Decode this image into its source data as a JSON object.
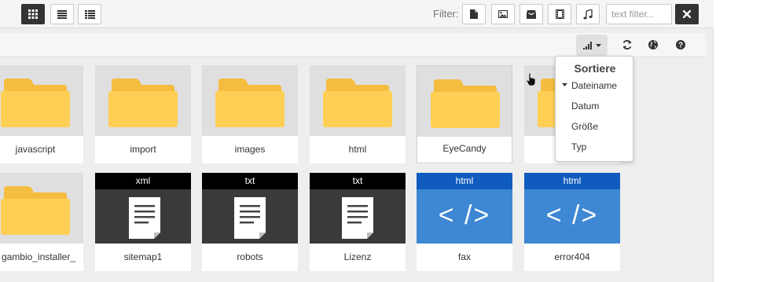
{
  "toolbar": {
    "view_buttons": [
      {
        "icon": "grid-view-icon",
        "active": true
      },
      {
        "icon": "list-view-icon",
        "active": false
      },
      {
        "icon": "columns-view-icon",
        "active": false
      }
    ],
    "filter_label": "Filter:",
    "filter_buttons": [
      "document-icon",
      "image-icon",
      "archive-icon",
      "video-icon",
      "music-icon"
    ],
    "filter_placeholder": "text filter...",
    "filter_value": "",
    "clear_icon": "close-icon"
  },
  "subbar": {
    "sort_icon": "signal-bars-icon",
    "icons": [
      "refresh-icon",
      "globe-icon",
      "help-icon"
    ]
  },
  "sort_menu": {
    "title": "Sortiere",
    "options": [
      "Dateiname",
      "Datum",
      "Größe",
      "Typ"
    ],
    "active": "Dateiname"
  },
  "files_row1": [
    {
      "name": "javascript",
      "kind": "folder"
    },
    {
      "name": "import",
      "kind": "folder"
    },
    {
      "name": "images",
      "kind": "folder"
    },
    {
      "name": "html",
      "kind": "folder"
    },
    {
      "name": "EyeCandy",
      "kind": "folder",
      "selected": true
    },
    {
      "name": "",
      "kind": "folder"
    }
  ],
  "files_row2": [
    {
      "name": "gambio_installer_",
      "kind": "folder"
    },
    {
      "name": "sitemap1",
      "kind": "doc",
      "ext": "xml"
    },
    {
      "name": "robots",
      "kind": "doc",
      "ext": "txt"
    },
    {
      "name": "Lizenz",
      "kind": "doc",
      "ext": "txt"
    },
    {
      "name": "fax",
      "kind": "code",
      "ext": "html"
    },
    {
      "name": "error404",
      "kind": "code",
      "ext": "html"
    }
  ],
  "code_glyph": "< />",
  "colors": {
    "doc_header": "#000000",
    "doc_body": "#3a3a3a",
    "code_header": "#0f5bbf",
    "code_body": "#3d87d3",
    "folder": "#ffcf55",
    "folder_tab": "#f4bd3f"
  }
}
